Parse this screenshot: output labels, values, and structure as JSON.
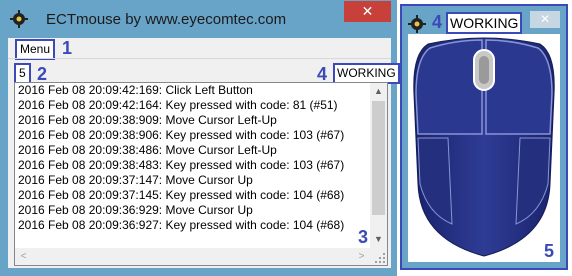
{
  "main_window": {
    "title": "ECTmouse by www.eyecomtec.com",
    "close_glyph": "✕",
    "menu": {
      "label": "Menu"
    },
    "counter": "5",
    "status": "WORKING",
    "log": [
      "2016 Feb 08 20:09:42:169: Click Left Button",
      "2016 Feb 08 20:09:42:164: Key pressed with code: 81 (#51)",
      "2016 Feb 08 20:09:38:909: Move Cursor Left-Up",
      "2016 Feb 08 20:09:38:906: Key pressed with code: 103 (#67)",
      "2016 Feb 08 20:09:38:486: Move Cursor Left-Up",
      "2016 Feb 08 20:09:38:483: Key pressed with code: 103 (#67)",
      "2016 Feb 08 20:09:37:147: Move Cursor Up",
      "2016 Feb 08 20:09:37:145: Key pressed with code: 104 (#68)",
      "2016 Feb 08 20:09:36:929: Move Cursor Up",
      "2016 Feb 08 20:09:36:927: Key pressed with code: 104 (#68)"
    ],
    "scroll_glyphs": {
      "up": "▲",
      "down": "▼",
      "left": "<",
      "right": ">"
    }
  },
  "mouse_window": {
    "status": "WORKING",
    "close_glyph": "✕"
  },
  "annotations": {
    "a1": "1",
    "a2": "2",
    "a3": "3",
    "a4_main": "4",
    "a4_mouse": "4",
    "a5": "5"
  },
  "colors": {
    "accent_annotation": "#3b4ab8",
    "titlebar": "#68a3c8",
    "close_button": "#c8403a",
    "mouse_body": "#1f2a7a",
    "mouse_highlight": "#3b4ea8"
  },
  "icons": {
    "app": "gear-icon",
    "scroll_up": "up-arrow-icon",
    "scroll_down": "down-arrow-icon"
  }
}
